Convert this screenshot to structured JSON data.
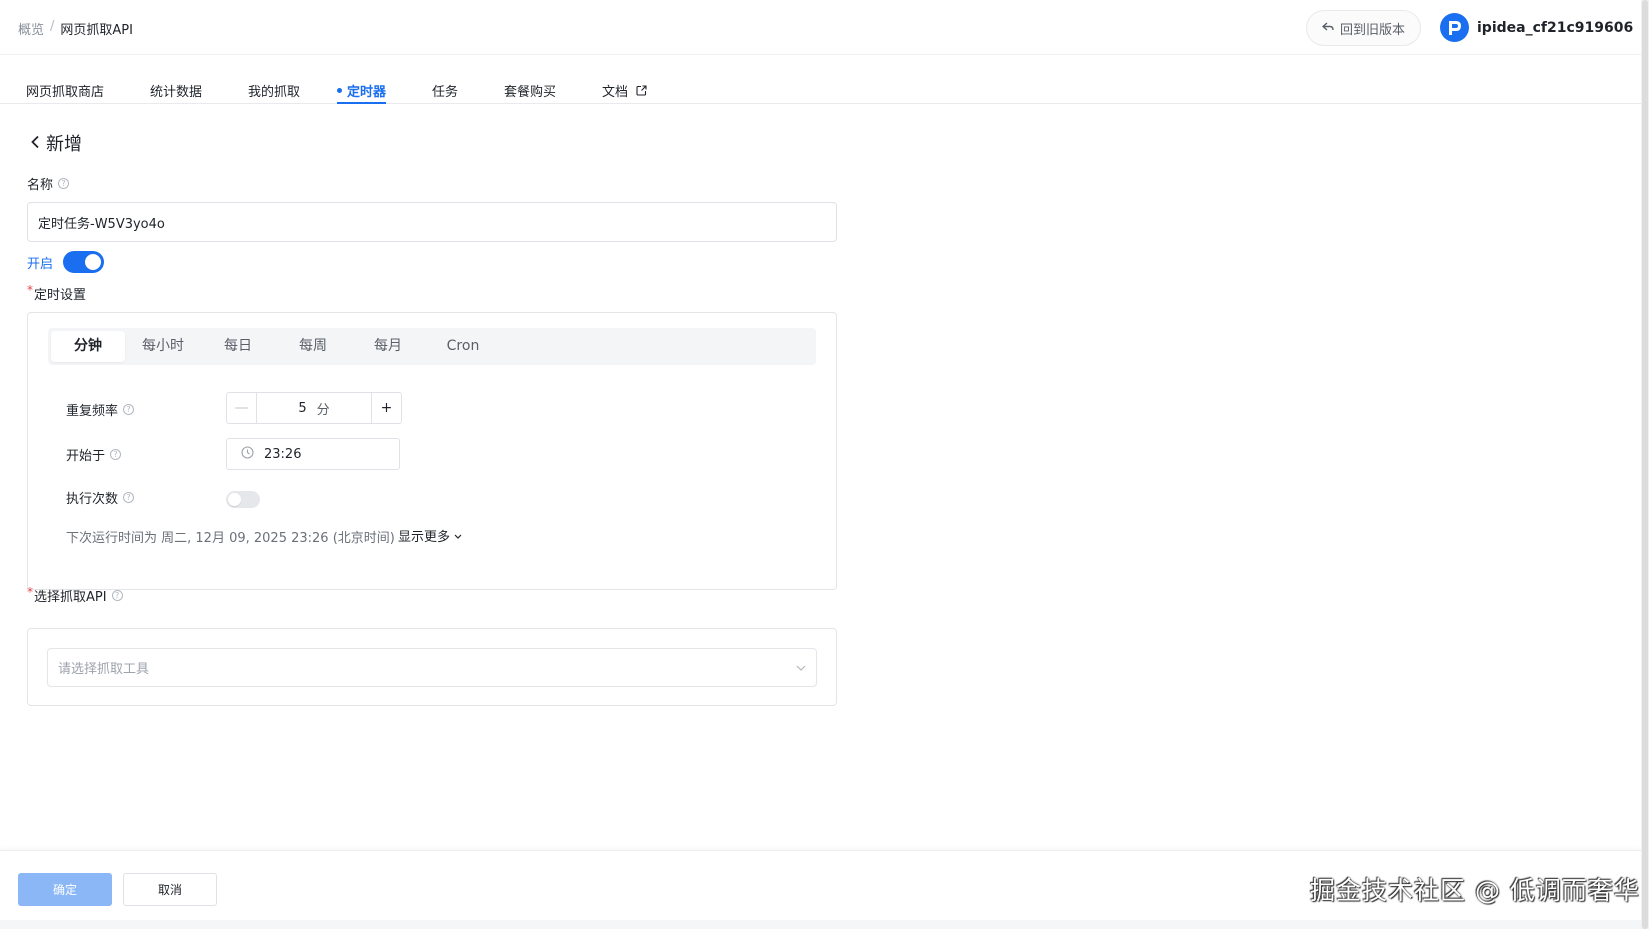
{
  "breadcrumb": {
    "home": "概览",
    "separator": "/",
    "current": "网页抓取API"
  },
  "header": {
    "old_version_label": "回到旧版本",
    "username": "ipidea_cf21c919606"
  },
  "tabs": [
    {
      "label": "网页抓取商店"
    },
    {
      "label": "统计数据"
    },
    {
      "label": "我的抓取"
    },
    {
      "label": "定时器",
      "active": true
    },
    {
      "label": "任务"
    },
    {
      "label": "套餐购买"
    },
    {
      "label": "文档"
    }
  ],
  "page": {
    "title": "新增"
  },
  "form": {
    "name_label": "名称",
    "name_value": "定时任务-W5V3yo4o",
    "enable_label": "开启",
    "enabled": true,
    "schedule_label": "定时设置",
    "schedule_tabs": [
      "分钟",
      "每小时",
      "每日",
      "每周",
      "每月",
      "Cron"
    ],
    "schedule_active": "分钟",
    "repeat_label": "重复频率",
    "repeat_value": "5",
    "repeat_unit": "分",
    "minus": "—",
    "plus": "+",
    "start_label": "开始于",
    "start_value": "23:26",
    "count_label": "执行次数",
    "count_enabled": false,
    "next_run": "下次运行时间为 周二, 12月 09, 2025 23:26 (北京时间)",
    "show_more": "显示更多",
    "api_label": "选择抓取API",
    "api_placeholder": "请选择抓取工具"
  },
  "footer": {
    "ok_label": "确定",
    "cancel_label": "取消",
    "watermark": "掘金技术社区 @ 低调而奢华"
  },
  "colors": {
    "primary": "#1a6ef0",
    "primary_disabled": "#8bb7f6",
    "required": "#e5484d"
  }
}
